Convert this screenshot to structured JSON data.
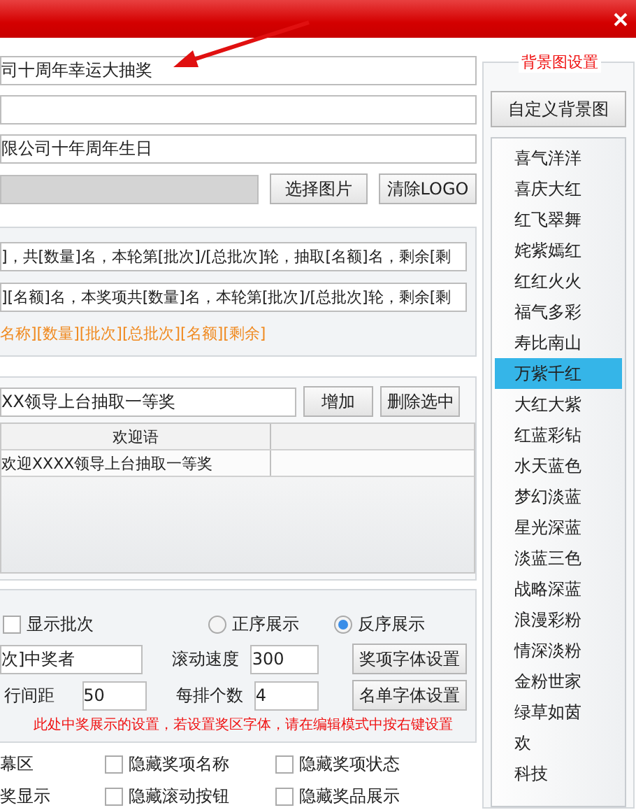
{
  "title_field": "司十周年幸运大抽奖",
  "company_field": "限公司十年周年生日",
  "logo": {
    "path_disabled": true,
    "buttons": [
      "选择图片",
      "清除LOGO"
    ]
  },
  "templates": [
    "]，共[数量]名，本轮第[批次]/[总批次]轮，抽取[名额]名，剩余[剩",
    "][名额]名，本奖项共[数量]名，本轮第[批次]/[总批次]轮，剩余[剩"
  ],
  "tokens": "名称][数量][批次][总批次][名额][剩余]",
  "greeting": {
    "value": "XX领导上台抽取一等奖",
    "buttons": [
      "增加",
      "删除选中"
    ],
    "columns": [
      "欢迎语"
    ],
    "rows": [
      "欢迎XXXX领导上台抽取一等奖"
    ]
  },
  "display": {
    "show_batch": {
      "label": "显示批次",
      "checked": false
    },
    "order": [
      {
        "label": "正序展示",
        "selected": false
      },
      {
        "label": "反序展示",
        "selected": true
      }
    ],
    "winner_title": "次]中奖者",
    "line_spacing": {
      "label": "行间距",
      "value": "50"
    },
    "scroll_speed": {
      "label": "滚动速度",
      "value": "300"
    },
    "per_row": {
      "label": "每排个数",
      "value": "4"
    },
    "buttons": [
      "奖项字体设置",
      "名单字体设置"
    ],
    "note": "此处中奖展示的设置，若设置奖区字体，请在编辑模式中按右键设置"
  },
  "options": [
    [
      {
        "kind": "label",
        "label": "幕区"
      },
      {
        "kind": "checkbox",
        "label": "隐藏奖项名称",
        "checked": false
      },
      {
        "kind": "checkbox",
        "label": "隐藏奖项状态",
        "checked": false
      }
    ],
    [
      {
        "kind": "label",
        "label": "奖显示"
      },
      {
        "kind": "checkbox",
        "label": "隐藏滚动按钮",
        "checked": false
      },
      {
        "kind": "checkbox",
        "label": "隐藏奖品展示",
        "checked": false
      }
    ]
  ],
  "background": {
    "title": "背景图设置",
    "button": "自定义背景图",
    "items": [
      {
        "label": "喜气洋洋",
        "selected": false
      },
      {
        "label": "喜庆大红",
        "selected": false
      },
      {
        "label": "红飞翠舞",
        "selected": false
      },
      {
        "label": "姹紫嫣红",
        "selected": false
      },
      {
        "label": "红红火火",
        "selected": false
      },
      {
        "label": "福气多彩",
        "selected": false
      },
      {
        "label": "寿比南山",
        "selected": false
      },
      {
        "label": "万紫千红",
        "selected": true
      },
      {
        "label": "大红大紫",
        "selected": false
      },
      {
        "label": "红蓝彩钻",
        "selected": false
      },
      {
        "label": "水天蓝色",
        "selected": false
      },
      {
        "label": "梦幻淡蓝",
        "selected": false
      },
      {
        "label": "星光深蓝",
        "selected": false
      },
      {
        "label": "淡蓝三色",
        "selected": false
      },
      {
        "label": "战略深蓝",
        "selected": false
      },
      {
        "label": "浪漫彩粉",
        "selected": false
      },
      {
        "label": "情深淡粉",
        "selected": false
      },
      {
        "label": "金粉世家",
        "selected": false
      },
      {
        "label": "绿草如茵",
        "selected": false
      },
      {
        "label": "欢",
        "selected": false
      },
      {
        "label": "科技",
        "selected": false
      }
    ]
  }
}
